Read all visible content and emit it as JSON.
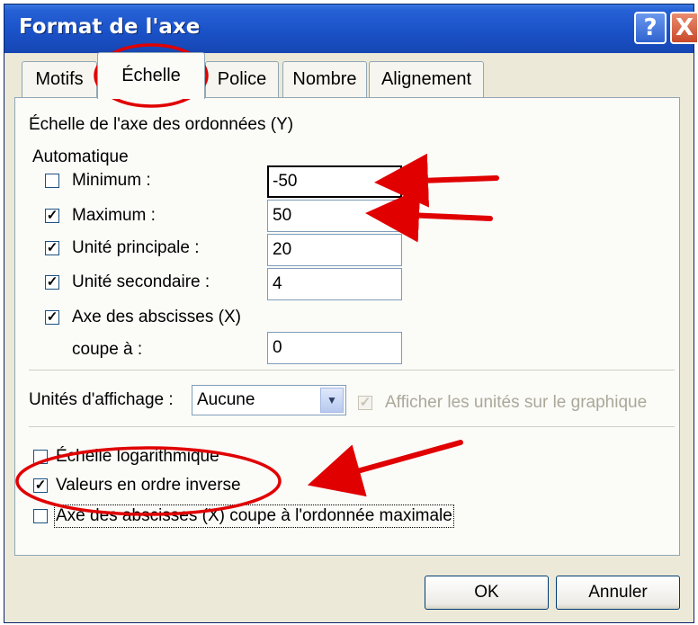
{
  "window": {
    "title": "Format de l'axe",
    "help_label": "?",
    "close_label": "X"
  },
  "tabs": [
    {
      "label": "Motifs",
      "active": false
    },
    {
      "label": "Échelle",
      "active": true
    },
    {
      "label": "Police",
      "active": false
    },
    {
      "label": "Nombre",
      "active": false
    },
    {
      "label": "Alignement",
      "active": false
    }
  ],
  "scale": {
    "section_title": "Échelle de l'axe des ordonnées (Y)",
    "auto_label": "Automatique",
    "minimum": {
      "label": "Minimum :",
      "checked": false,
      "value": "-50"
    },
    "maximum": {
      "label": "Maximum :",
      "checked": true,
      "value": "50"
    },
    "major_unit": {
      "label": "Unité principale :",
      "checked": true,
      "value": "20"
    },
    "minor_unit": {
      "label": "Unité secondaire :",
      "checked": true,
      "value": "4"
    },
    "crosses": {
      "label": "Axe des abscisses (X)",
      "sub_label": "coupe à :",
      "checked": true,
      "value": "0"
    }
  },
  "display_units": {
    "label": "Unités d'affichage :",
    "selected": "Aucune",
    "show_label": "Afficher les unités sur le graphique",
    "show_checked": true
  },
  "options": {
    "log_scale": {
      "label": "Échelle logarithmique",
      "checked": false
    },
    "reverse": {
      "label": "Valeurs en ordre inverse",
      "checked": true
    },
    "cross_max": {
      "label": "Axe des abscisses (X) coupe à l'ordonnée maximale",
      "checked": false
    }
  },
  "buttons": {
    "ok": "OK",
    "cancel": "Annuler"
  },
  "colors": {
    "titlebar": "#1a52c8",
    "dialog_bg": "#ece9d8",
    "annotation_red": "#e00000"
  },
  "check_mark": "✓"
}
